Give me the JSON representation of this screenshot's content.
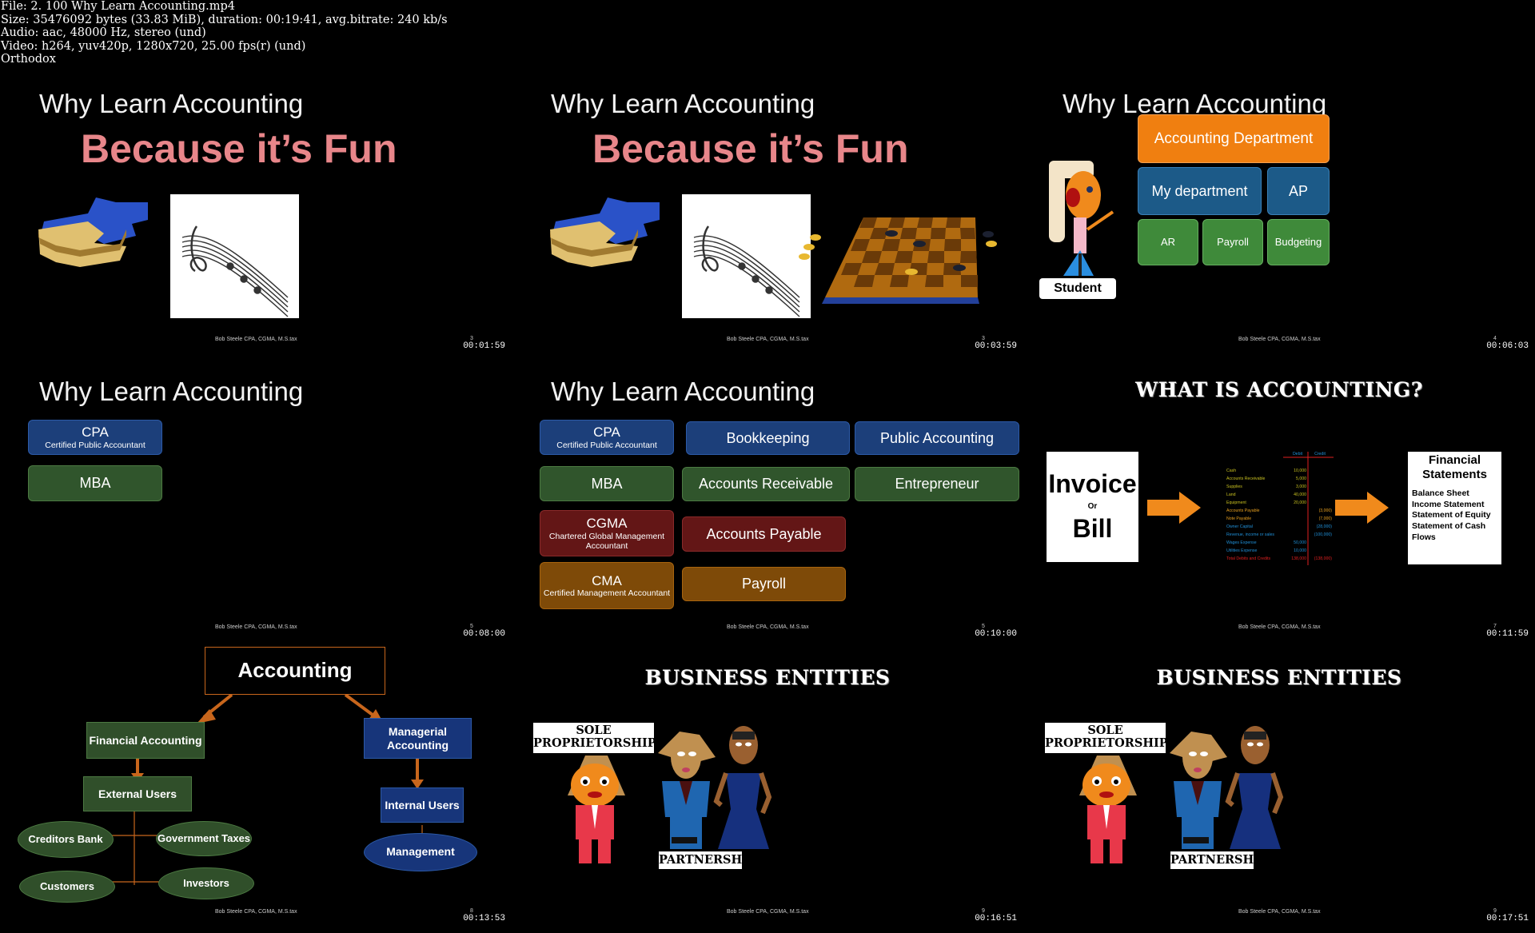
{
  "header": {
    "file_line": "File: 2. 100 Why Learn Accounting.mp4",
    "size_line": "Size: 35476092 bytes (33.83 MiB), duration: 00:19:41, avg.bitrate: 240 kb/s",
    "audio_line": "Audio: aac, 48000 Hz, stereo (und)",
    "video_line": "Video: h264, yuv420p, 1280x720, 25.00 fps(r) (und)",
    "extra_line": "Orthodox"
  },
  "common": {
    "slide_title": "Why Learn Accounting",
    "footer": "Bob Steele CPA, CGMA, M.S.tax"
  },
  "frames": [
    {
      "timestamp": "00:01:59",
      "page": "3",
      "headline": "Because it’s Fun"
    },
    {
      "timestamp": "00:03:59",
      "page": "3",
      "headline": "Because it’s Fun"
    },
    {
      "timestamp": "00:06:03",
      "page": "4",
      "student_label": "Student",
      "boxes": {
        "dept": "Accounting Department",
        "mydept": "My department",
        "ap": "AP",
        "ar": "AR",
        "payroll": "Payroll",
        "budgeting": "Budgeting"
      }
    },
    {
      "timestamp": "00:08:00",
      "page": "5",
      "cpa": "CPA",
      "cpa_sub": "Certified Public Accountant",
      "mba": "MBA"
    },
    {
      "timestamp": "00:10:00",
      "page": "5",
      "cpa": "CPA",
      "cpa_sub": "Certified Public Accountant",
      "mba": "MBA",
      "cgma": "CGMA",
      "cgma_sub": "Chartered Global Management Accountant",
      "cma": "CMA",
      "cma_sub": "Certified Management Accountant",
      "bookkeeping": "Bookkeeping",
      "public_accounting": "Public Accounting",
      "ar": "Accounts Receivable",
      "entrepreneur": "Entrepreneur",
      "ap": "Accounts Payable",
      "payroll": "Payroll"
    },
    {
      "timestamp": "00:11:59",
      "page": "7",
      "heading": "WHAT IS ACCOUNTING?",
      "invoice": "Invoice",
      "or": "Or",
      "bill": "Bill",
      "fs_title": "Financial Statements",
      "fs_items": [
        "Balance Sheet",
        "Income Statement",
        "Statement of Equity",
        "Statement of Cash Flows"
      ],
      "tb_headers": [
        "Debit",
        "Credit"
      ],
      "tb_rows": [
        {
          "name": "Cash",
          "debit": "10,000",
          "credit": "",
          "color": "#c8c020"
        },
        {
          "name": "Accounts Receivable",
          "debit": "5,000",
          "credit": "",
          "color": "#c8c020"
        },
        {
          "name": "Supplies",
          "debit": "3,000",
          "credit": "",
          "color": "#c8c020"
        },
        {
          "name": "Land",
          "debit": "40,000",
          "credit": "",
          "color": "#c8c020"
        },
        {
          "name": "Equipment",
          "debit": "20,000",
          "credit": "",
          "color": "#c8c020"
        },
        {
          "name": "Accounts Payable",
          "debit": "",
          "credit": "(3,000)",
          "color": "#e8a020"
        },
        {
          "name": "Note Payable",
          "debit": "",
          "credit": "(7,000)",
          "color": "#e8a020"
        },
        {
          "name": "Owner Capital",
          "debit": "",
          "credit": "(28,000)",
          "color": "#2090d8"
        },
        {
          "name": "Revenue, income or sales",
          "debit": "",
          "credit": "(100,000)",
          "color": "#2090d8"
        },
        {
          "name": "Wages Expense",
          "debit": "50,000",
          "credit": "",
          "color": "#2090d8"
        },
        {
          "name": "Utilities Expense",
          "debit": "10,000",
          "credit": "",
          "color": "#2090d8"
        },
        {
          "name": "Total Debits and Credits",
          "debit": "138,000",
          "credit": "(138,000)",
          "color": "#e02020"
        }
      ]
    },
    {
      "timestamp": "00:13:53",
      "page": "8",
      "accounting": "Accounting",
      "financial": "Financial Accounting",
      "managerial": "Managerial Accounting",
      "external": "External Users",
      "internal": "Internal Users",
      "management": "Management",
      "creditors": "Creditors Bank",
      "government": "Government Taxes",
      "customers": "Customers",
      "investors": "Investors"
    },
    {
      "timestamp": "00:16:51",
      "page": "9",
      "heading": "BUSINESS ENTITIES",
      "sole": "SOLE PROPRIETORSHIP",
      "partnership": "PARTNERSHIP"
    },
    {
      "timestamp": "00:17:51",
      "page": "9",
      "heading": "BUSINESS ENTITIES",
      "sole": "SOLE PROPRIETORSHIP",
      "partnership": "PARTNERSHIP"
    }
  ]
}
